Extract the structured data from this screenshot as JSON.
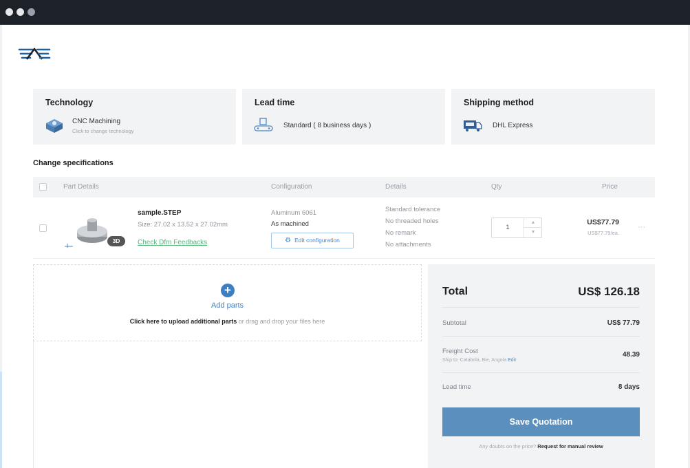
{
  "technology": {
    "title": "Technology",
    "value": "CNC Machining",
    "hint": "Click to change technology"
  },
  "lead_time": {
    "title": "Lead time",
    "value": "Standard ( 8 business days )"
  },
  "shipping": {
    "title": "Shipping method",
    "value": "DHL Express"
  },
  "specs": {
    "title": "Change specifications",
    "columns": [
      "Part Details",
      "Configuration",
      "Details",
      "Qty",
      "Price"
    ]
  },
  "part": {
    "name": "sample.STEP",
    "size": "Size: 27.02 x 13.52 x 27.02mm",
    "badge": "3D",
    "dfm_link": "Check Dfm Feedbacks",
    "material": "Aluminum 6061",
    "finish": "As machined",
    "edit_button": "Edit configuration",
    "details": [
      "Standard tolerance",
      "No threaded holes",
      "No remark",
      "No attachments"
    ],
    "qty": "1",
    "price": "US$77.79",
    "price_each": "US$77.79/ea.",
    "more": "···"
  },
  "upload": {
    "title": "Add parts",
    "hint_bold": "Click here to upload additional parts",
    "hint_rest": " or drag and drop your files here"
  },
  "summary": {
    "total_label": "Total",
    "total_value": "US$ 126.18",
    "subtotal_label": "Subtotal",
    "subtotal_value": "US$ 77.79",
    "freight_label": "Freight Cost",
    "freight_value": "48.39",
    "ship_to_prefix": "Ship to: Catabola, Bie, Angola",
    "ship_to_edit": "Edit",
    "lead_label": "Lead time",
    "lead_value": "8 days",
    "save_button": "Save Quotation",
    "doubt_text": "Any doubts on the price? ",
    "doubt_link": "Request for manual review"
  },
  "colors": {
    "accent": "#3d7fc1",
    "save_button": "#5b8fbd",
    "link_green": "#55b47a",
    "panel_bg": "#f2f3f5",
    "titlebar": "#1d2128"
  }
}
